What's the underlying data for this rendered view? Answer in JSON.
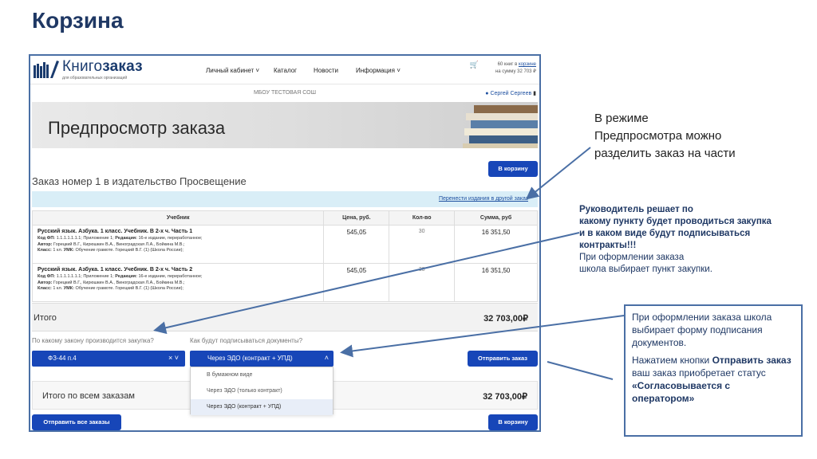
{
  "slide": {
    "title": "Корзина"
  },
  "site": {
    "logo_regular": "Книго",
    "logo_bold": "заказ",
    "logo_sub": "для образовательных организаций",
    "nav": [
      "Личный кабинет",
      "Каталог",
      "Новости",
      "Информация"
    ],
    "cart_line1": "60 книг в",
    "cart_link": "корзине",
    "cart_line2": "на сумму 32 703 ₽",
    "school": "МБОУ ТЕСТОВАЯ СОШ",
    "user": "Сергей Сергеев"
  },
  "banner": {
    "title": "Предпросмотр заказа"
  },
  "order": {
    "title": "Заказ номер 1 в издательство Просвещение",
    "to_cart_label": "В корзину",
    "transfer_link": "Перенести издания в другой заказ",
    "columns": [
      "Учебник",
      "Цена, руб.",
      "Кол-во",
      "Сумма, руб"
    ],
    "items": [
      {
        "title": "Русский язык. Азбука. 1 класс. Учебник. В 2-х ч. Часть 1",
        "meta1_label": "Код ФП:",
        "meta1_value": "1.1.1.1.1.1.1; Приложение 1;",
        "meta1b_label": "Редакция:",
        "meta1b_value": "16-е издание, переработанное;",
        "meta2_label": "Автор:",
        "meta2_value": "Горецкий В.Г., Кирюшкин В.А., Виноградская Л.А., Бойкина М.В.;",
        "meta3_label": "Класс:",
        "meta3_value": "1 кл.",
        "meta3b_label": "УМК:",
        "meta3b_value": "Обучение грамоте. Горецкий В.Г. (1) (Школа России);",
        "price": "545,05",
        "qty": "30",
        "sum": "16 351,50"
      },
      {
        "title": "Русский язык. Азбука. 1 класс. Учебник. В 2-х ч. Часть 2",
        "meta1_label": "Код ФП:",
        "meta1_value": "1.1.1.1.1.1.1; Приложение 1;",
        "meta1b_label": "Редакция:",
        "meta1b_value": "16-е издание, переработанное;",
        "meta2_label": "Автор:",
        "meta2_value": "Горецкий В.Г., Кирюшкин В.А., Виноградская Л.А., Бойкина М.В.;",
        "meta3_label": "Класс:",
        "meta3_value": "1 кл.",
        "meta3b_label": "УМК:",
        "meta3b_value": "Обучение грамоте. Горецкий В.Г. (1) (Школа России);",
        "price": "545,05",
        "qty": "30",
        "sum": "16 351,50"
      }
    ],
    "total_label": "Итого",
    "total_value": "32 703,00₽",
    "q_law": "По какому закону производится закупка?",
    "q_docs": "Как будут подписываться документы?",
    "law_value": "ФЗ-44 п.4",
    "docs_value": "Через ЭДО (контракт + УПД)",
    "docs_options": [
      "В бумажном виде",
      "Через ЭДО (только контракт)",
      "Через ЭДО (контракт + УПД)"
    ],
    "send_label": "Отправить заказ",
    "all_total_label": "Итого по всем заказам",
    "all_total_value": "32 703,00₽",
    "send_all_label": "Отправить все заказы",
    "to_cart_bottom_label": "В корзину"
  },
  "notes": {
    "n1_line1": "В режиме",
    "n1_line2": "Предпросмотра  можно",
    "n1_line3": "разделить заказ на  части",
    "n2_b1": "Руководитель решает по",
    "n2_b2": "какому пункту будет проводиться закупка",
    "n2_b3": "и в каком  виде будут подписываться",
    "n2_b4": "контракты!!!",
    "n2_l1": "При оформлении заказа",
    "n2_l2": "школа  выбирает пункт закупки.",
    "n3_p1": "При оформлении заказа школа  выбирает форму подписания документов.",
    "n3_p2a": "Нажатием кнопки ",
    "n3_p2b": "Отправить заказ",
    "n3_p2c": " ваш заказ приобретает статус ",
    "n3_p2d": "«Согласовывается с оператором»"
  },
  "colors": {
    "accent": "#1746b8",
    "frame": "#4a6fa5",
    "title": "#1f3864"
  }
}
